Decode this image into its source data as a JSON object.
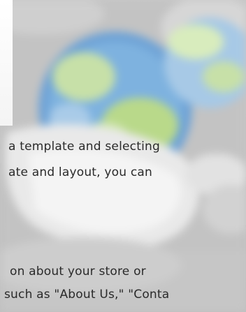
{
  "article": {
    "lines": [
      "a template and selecting",
      "ate and layout, you can",
      "on about your store or",
      "such as \"About Us,\" \"Conta"
    ]
  },
  "colors": {
    "background": "#c4c4c4",
    "text": "#2a2a2a",
    "globe_blue": "#6fa3d6",
    "globe_green": "#b9d98a"
  },
  "hero": {
    "icon": "blurred-globe-network-icon"
  }
}
